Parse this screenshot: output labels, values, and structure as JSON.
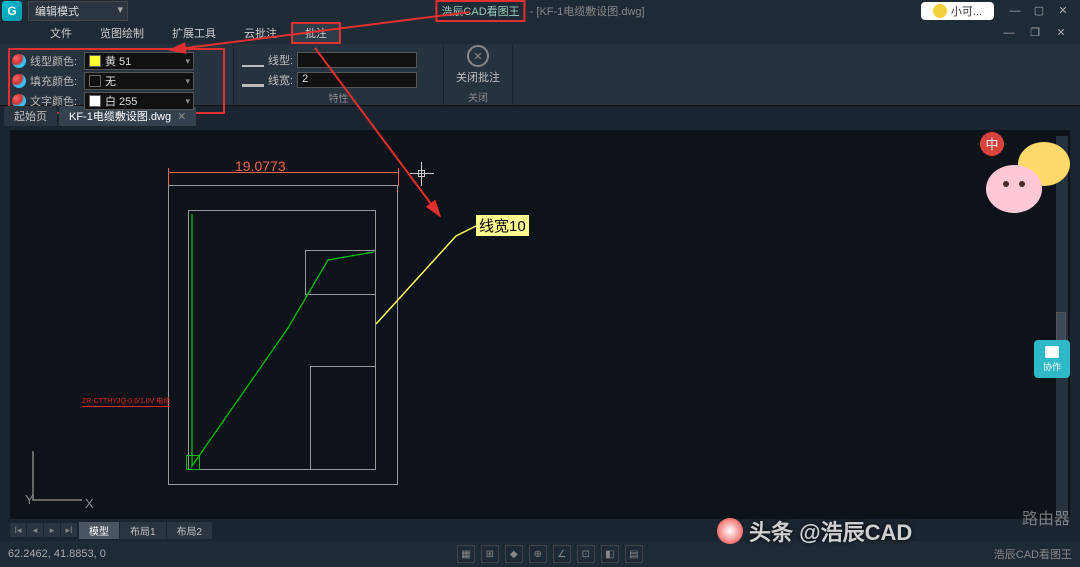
{
  "title": {
    "app": "浩辰CAD看图王",
    "file": "- [KF-1电缆敷设图.dwg]"
  },
  "mode": "编辑模式",
  "user": "小可...",
  "menu": {
    "file": "文件",
    "view": "览图绘制",
    "ext": "扩展工具",
    "cloud": "云批注",
    "annot": "批注"
  },
  "props": {
    "line_color_label": "线型颜色:",
    "line_color_val": "黄 51",
    "fill_color_label": "填充颜色:",
    "fill_color_val": "无",
    "text_color_label": "文字颜色:",
    "text_color_val": "白 255",
    "group_label": "特性"
  },
  "line": {
    "type_label": "线型:",
    "width_label": "线宽:",
    "width_val": "2"
  },
  "close": {
    "btn": "关闭批注",
    "group": "关闭"
  },
  "tabs": {
    "start": "起始页",
    "dwg": "KF-1电缆敷设图.dwg"
  },
  "canvas": {
    "dim": "19.0773",
    "axis_y": "Y",
    "axis_x": "X",
    "callout": "线宽10",
    "red_small": "ZR-CTTHYJQ-0.6/1.0V 电缆"
  },
  "layout": {
    "model": "模型",
    "l1": "布局1",
    "l2": "布局2"
  },
  "status": {
    "coords": "62.2462, 41.8853, 0",
    "brand": "浩辰CAD看图王"
  },
  "coop": "协作",
  "watermark": {
    "toutiao": "头条 @浩辰CAD",
    "router": "路由器"
  },
  "mascot_badge": "中"
}
